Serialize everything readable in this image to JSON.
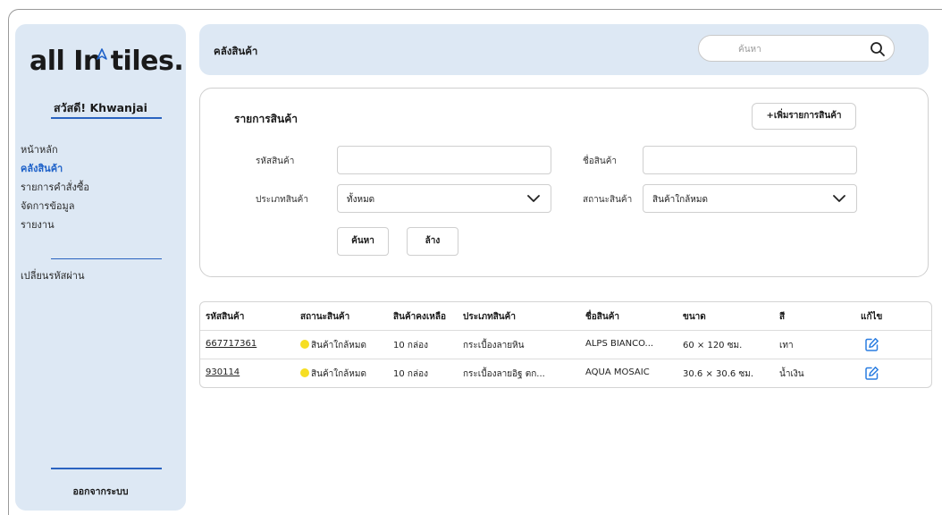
{
  "sidebar": {
    "logo_text": "all In tiles.",
    "greeting": "สวัสดี! Khwanjai",
    "nav": [
      "หน้าหลัก",
      "คลังสินค้า",
      "รายการคำสั่งซื้อ",
      "จัดการข้อมูล",
      "รายงาน"
    ],
    "active_index": 1,
    "change_password": "เปลี่ยนรหัสผ่าน",
    "logout": "ออกจากระบบ"
  },
  "header": {
    "title": "คลังสินค้า",
    "search_placeholder": "ค้นหา"
  },
  "filter": {
    "title": "รายการสินค้า",
    "add_button": "+เพิ่มรายการสินค้า",
    "code_label": "รหัสสินค้า",
    "code_value": "",
    "name_label": "ชื่อสินค้า",
    "name_value": "",
    "type_label": "ประเภทสินค้า",
    "type_value": "ทั้งหมด",
    "status_label": "สถานะสินค้า",
    "status_value": "สินค้าใกล้หมด",
    "search_button": "ค้นหา",
    "clear_button": "ล้าง"
  },
  "table": {
    "headers": [
      "รหัสสินค้า",
      "สถานะสินค้า",
      "สินค้าคงเหลือ",
      "ประเภทสินค้า",
      "ชื่อสินค้า",
      "ขนาด",
      "สี",
      "แก้ไข"
    ],
    "rows": [
      [
        "667717361",
        "สินค้าใกล้หมด",
        "10 กล่อง",
        "กระเบื้องลายหิน",
        "ALPS BIANCO...",
        "60 × 120 ซม.",
        "เทา"
      ],
      [
        "930114",
        "สินค้าใกล้หมด",
        "10 กล่อง",
        "กระเบื้องลายอิฐ ตก...",
        "AQUA MOSAIC",
        "30.6 × 30.6 ซม.",
        "น้ำเงิน"
      ]
    ]
  },
  "colors": {
    "accent": "#1f62c9",
    "panel": "#dde8f4",
    "status_warning": "#f6de23"
  },
  "icons": {
    "search": "search-icon",
    "edit": "edit-icon",
    "dropdown": "chevron-down-icon",
    "logo_arrow": "arrow-icon"
  }
}
